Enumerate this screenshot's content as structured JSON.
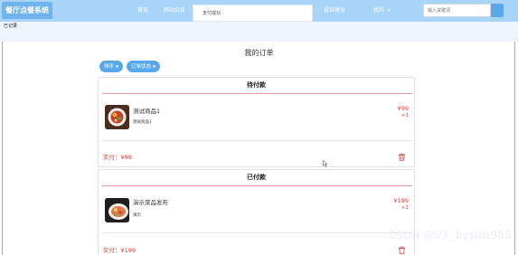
{
  "header": {
    "brand": "餐厅点餐系统",
    "nav": [
      "首页",
      "网站公告",
      "投诉建议"
    ],
    "account": "我的",
    "account_chevron": "chevron-down-icon",
    "search": {
      "placeholder": "输入关键词",
      "icon": "search-icon"
    },
    "toast": "支付成功"
  },
  "back_link": "已记录",
  "page_title": "我的订单",
  "filters": [
    {
      "label": "排序",
      "icon": "caret-down-icon"
    },
    {
      "label": "订单状态",
      "icon": "caret-down-icon"
    }
  ],
  "orders": [
    {
      "status": "待付款",
      "item": {
        "name": "测试商品1",
        "desc": "测试商品1",
        "price": "¥99",
        "qty": "×1"
      },
      "total": "实付：¥99",
      "delete_icon": "trash-icon"
    },
    {
      "status": "已付款",
      "item": {
        "name": "演示菜品发布",
        "desc": "演示",
        "price": "¥199",
        "qty": "×1"
      },
      "total": "实付：¥199",
      "delete_icon": "trash-icon"
    }
  ],
  "watermark": "CSDN @VX_bysjlw985",
  "colors": {
    "nav": "#a8d4f8",
    "accent": "#5aa8ec",
    "price": "#e03a3a"
  }
}
